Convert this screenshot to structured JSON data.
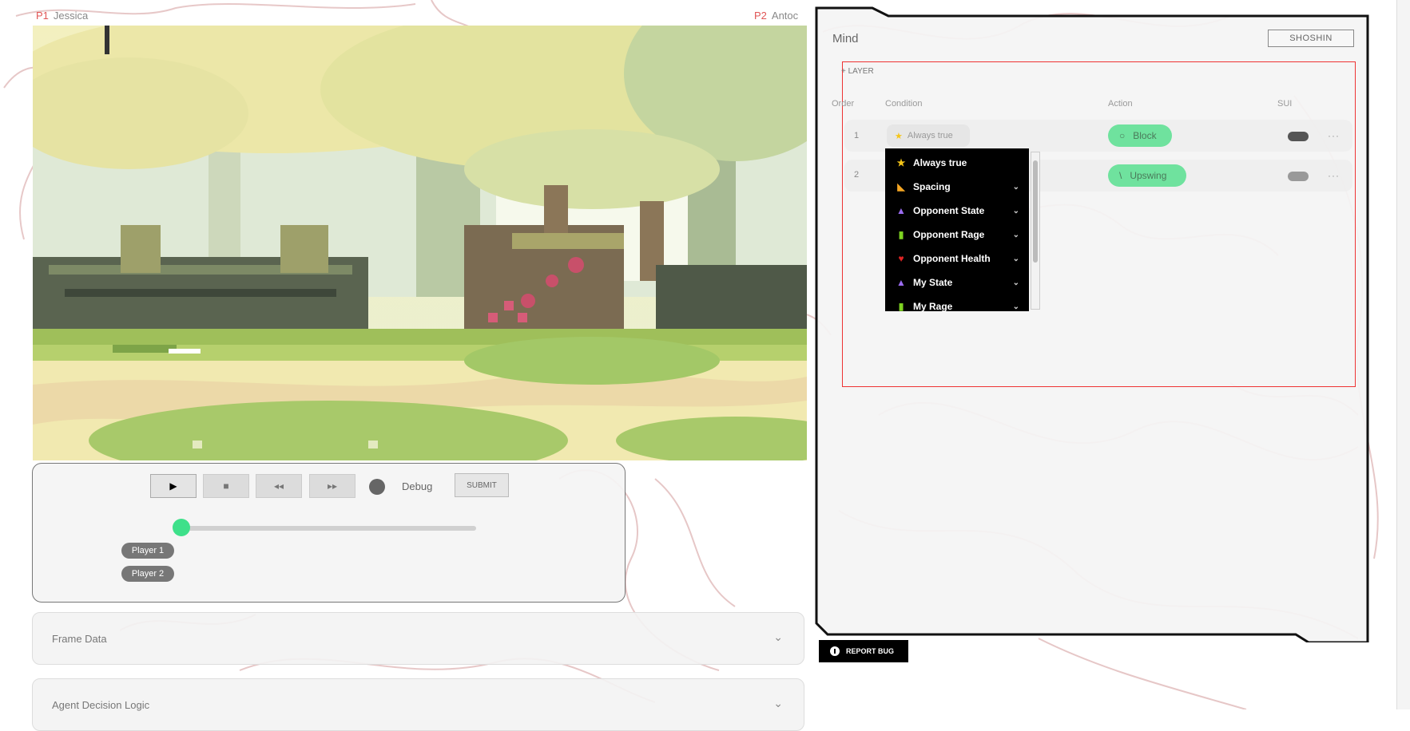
{
  "players": {
    "p1": {
      "tag": "P1",
      "name": "Jessica"
    },
    "p2": {
      "tag": "P2",
      "name": "Antoc"
    }
  },
  "controls": {
    "play_icon": "play-icon",
    "stop_icon": "stop-icon",
    "rewind_icon": "rewind-icon",
    "forward_icon": "fast-forward-icon",
    "debug_label": "Debug",
    "submit_label": "SUBMIT",
    "slider_value": 0.0,
    "player1_label": "Player 1",
    "player2_label": "Player 2",
    "accent": "#3ee08a"
  },
  "accordions": [
    {
      "label": "Frame Data"
    },
    {
      "label": "Agent Decision Logic"
    }
  ],
  "mind": {
    "title": "Mind",
    "shoshin_label": "SHOSHIN",
    "add_layer_label": "LAYER",
    "columns": {
      "order": "Order",
      "condition": "Condition",
      "action": "Action",
      "sui": "SUI"
    },
    "rows": [
      {
        "order": "1",
        "condition": "Always true",
        "action": "Block"
      },
      {
        "order": "2",
        "condition": "",
        "action": "Upswing"
      }
    ],
    "dropdown_items": [
      {
        "label": "Always true",
        "icon": "star-icon",
        "color": "#f5c518",
        "has_chevron": false
      },
      {
        "label": "Spacing",
        "icon": "ruler-icon",
        "color": "#f5a623",
        "has_chevron": true
      },
      {
        "label": "Opponent State",
        "icon": "flask-icon",
        "color": "#9b6cf0",
        "has_chevron": true
      },
      {
        "label": "Opponent Rage",
        "icon": "battery-icon",
        "color": "#7ed321",
        "has_chevron": true
      },
      {
        "label": "Opponent Health",
        "icon": "heart-icon",
        "color": "#e02424",
        "has_chevron": true
      },
      {
        "label": "My State",
        "icon": "flask-icon",
        "color": "#9b6cf0",
        "has_chevron": true
      },
      {
        "label": "My Rage",
        "icon": "battery-icon",
        "color": "#7ed321",
        "has_chevron": true
      }
    ],
    "highlight_color": "#e33333",
    "action_color": "#6fe29e"
  },
  "report_bug_label": "REPORT BUG"
}
